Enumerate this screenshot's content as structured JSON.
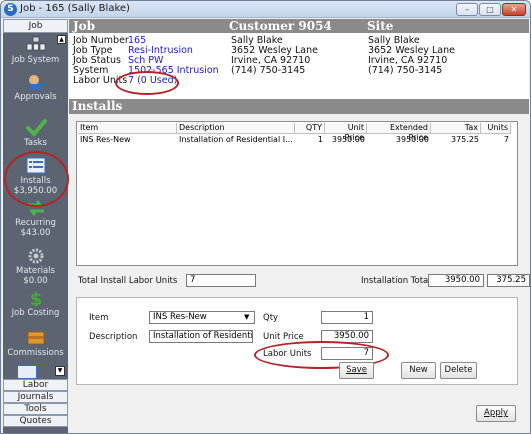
{
  "window": {
    "title": "Job - 165 (Sally Blake)",
    "minimize": "–",
    "maximize": "□",
    "close": "✕"
  },
  "sidebar": {
    "top_tab": "Job",
    "items": [
      {
        "label": "Job System",
        "amount": ""
      },
      {
        "label": "Approvals",
        "amount": ""
      },
      {
        "label": "Tasks",
        "amount": ""
      },
      {
        "label": "Installs",
        "amount": "$3,950.00"
      },
      {
        "label": "Recurring",
        "amount": "$43.00"
      },
      {
        "label": "Materials",
        "amount": "$0.00"
      },
      {
        "label": "Job Costing",
        "amount": ""
      },
      {
        "label": "Commissions",
        "amount": ""
      }
    ],
    "bottom_tabs": [
      "Labor",
      "Journals",
      "Tools",
      "Quotes"
    ]
  },
  "header": {
    "job_title": "Job",
    "customer_title": "Customer 9054",
    "site_title": "Site",
    "fields": [
      {
        "label": "Job Number",
        "value": "165"
      },
      {
        "label": "Job Type",
        "value": "Resi-Intrusion"
      },
      {
        "label": "Job Status",
        "value": "Sch PW"
      },
      {
        "label": "System",
        "value": "1502-565 Intrusion"
      },
      {
        "label": "Labor Units",
        "value": "7 (0 Used)"
      }
    ],
    "customer_lines": [
      "Sally Blake",
      "3652 Wesley Lane",
      "Irvine, CA  92710",
      "(714) 750-3145"
    ],
    "site_lines": [
      "Sally Blake",
      "3652 Wesley Lane",
      "Irvine, CA  92710",
      "(714) 750-3145"
    ]
  },
  "installs": {
    "section_title": "Installs",
    "columns": [
      "Item",
      "Description",
      "QTY",
      "Unit Price",
      "Extended Price",
      "Tax",
      "Units"
    ],
    "rows": [
      [
        "INS Res-New",
        "Installation of Residential I...",
        "1",
        "3950.00",
        "3950.00",
        "375.25",
        "7"
      ]
    ],
    "total_labor_label": "Total Install Labor Units",
    "total_labor_value": "7",
    "totals_label": "Installation Totals",
    "totals_value": "3950.00",
    "totals_tax": "375.25"
  },
  "detail": {
    "item_label": "Item",
    "item_value": "INS Res-New",
    "description_label": "Description",
    "description_value": "Installation of Residential Intrusi",
    "qty_label": "Qty",
    "qty_value": "1",
    "unit_price_label": "Unit Price",
    "unit_price_value": "3950.00",
    "labor_units_label": "Labor Units",
    "labor_units_value": "7",
    "save": "Save",
    "new": "New",
    "delete": "Delete"
  },
  "apply": "Apply",
  "colors": {
    "band": "#8a8a8a",
    "sidebar": "#5b6470",
    "highlight": "#b3232a",
    "link": "#2020c0"
  }
}
